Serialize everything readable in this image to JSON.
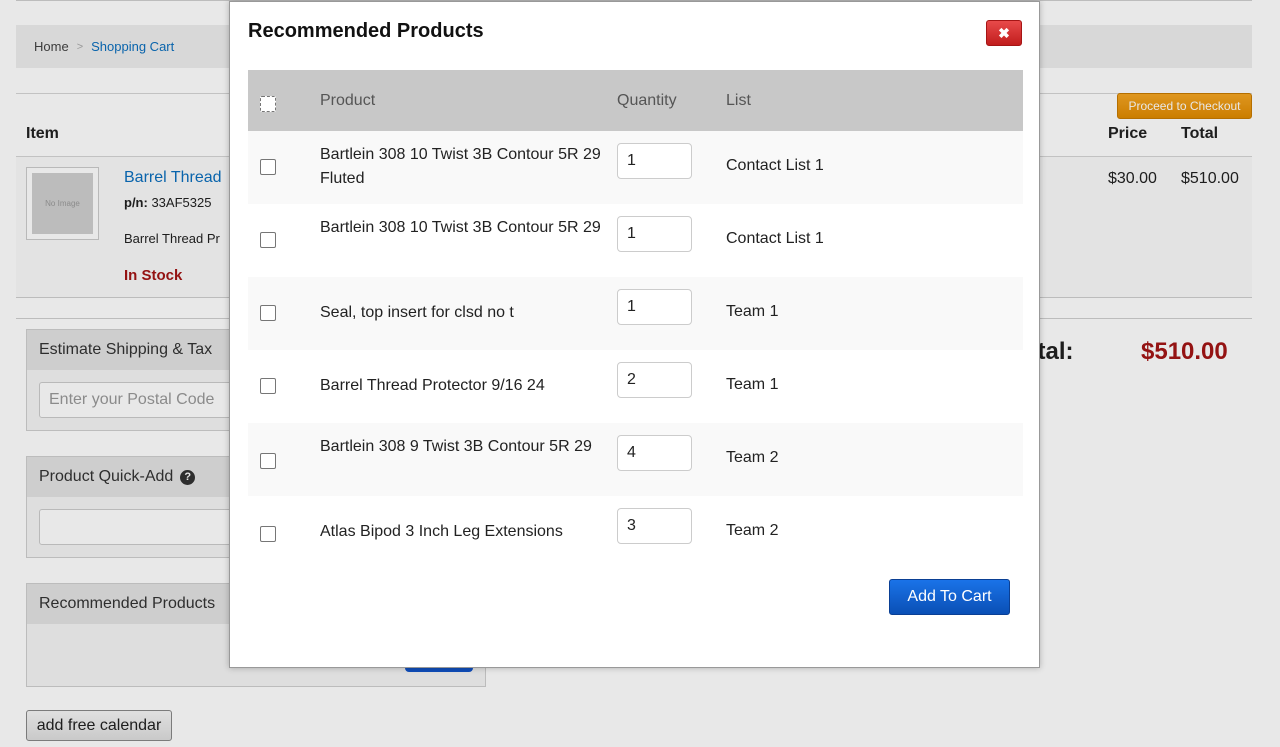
{
  "breadcrumb": {
    "home": "Home",
    "separator": ">",
    "current": "Shopping Cart"
  },
  "checkout_button": "Proceed to Checkout",
  "cart": {
    "columns": {
      "item": "Item",
      "price": "Price",
      "total": "Total"
    },
    "item": {
      "thumb_text": "No Image",
      "name": "Barrel Thread",
      "pn_label": "p/n:",
      "pn_value": "33AF5325",
      "description": "Barrel Thread Pr",
      "stock": "In Stock",
      "price": "$30.00",
      "total": "$510.00"
    },
    "grand_total_label": "Total:",
    "grand_total_value": "$510.00"
  },
  "panels": {
    "shipping": {
      "title": "Estimate Shipping & Tax",
      "placeholder": "Enter your Postal Code"
    },
    "quick_add": {
      "title": "Product Quick-Add",
      "help_icon": "?"
    },
    "recommended": {
      "title": "Recommended Products"
    }
  },
  "calendar_button": "add free calendar",
  "modal": {
    "title": "Recommended Products",
    "close_icon": "✖",
    "headers": {
      "product": "Product",
      "quantity": "Quantity",
      "list": "List"
    },
    "rows": [
      {
        "product": "Bartlein 308 10 Twist 3B Contour 5R 29 Fluted",
        "quantity": "1",
        "list": "Contact List 1"
      },
      {
        "product": "Bartlein 308 10 Twist 3B Contour 5R 29",
        "quantity": "1",
        "list": "Contact List 1"
      },
      {
        "product": "Seal, top insert for clsd no t",
        "quantity": "1",
        "list": "Team 1"
      },
      {
        "product": "Barrel Thread Protector 9/16 24",
        "quantity": "2",
        "list": "Team 1"
      },
      {
        "product": "Bartlein 308 9 Twist 3B Contour 5R 29",
        "quantity": "4",
        "list": "Team 2"
      },
      {
        "product": "Atlas Bipod 3 Inch Leg Extensions",
        "quantity": "3",
        "list": "Team 2"
      }
    ],
    "add_button": "Add To Cart"
  },
  "colors": {
    "accent_red": "#a31515",
    "link_blue": "#0a6ebd",
    "checkout_orange": "#f5a623",
    "button_blue": "#1a73e8"
  }
}
